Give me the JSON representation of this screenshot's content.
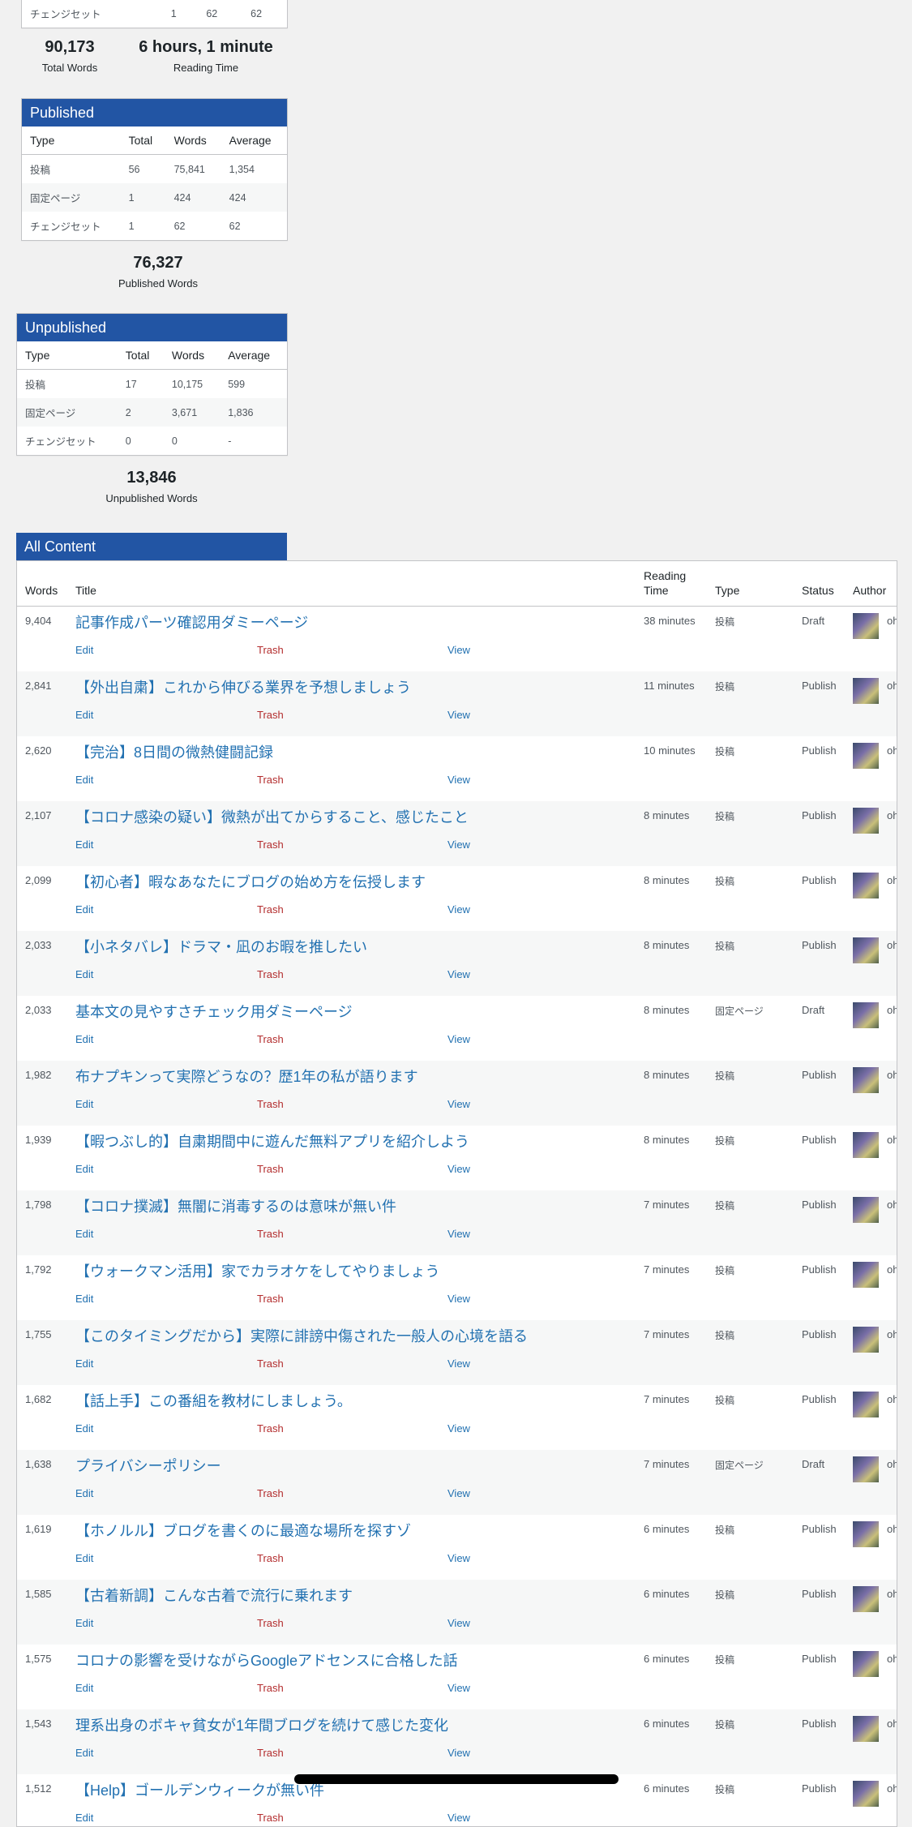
{
  "top_table": {
    "rows": [
      {
        "type": "チェンジセット",
        "total": "1",
        "words": "62",
        "average": "62"
      }
    ]
  },
  "total_words": {
    "value": "90,173",
    "label": "Total Words"
  },
  "reading_time": {
    "value": "6 hours, 1 minute",
    "label": "Reading Time"
  },
  "published": {
    "title": "Published",
    "headers": [
      "Type",
      "Total",
      "Words",
      "Average"
    ],
    "rows": [
      {
        "type": "投稿",
        "total": "56",
        "words": "75,841",
        "average": "1,354"
      },
      {
        "type": "固定ページ",
        "total": "1",
        "words": "424",
        "average": "424"
      },
      {
        "type": "チェンジセット",
        "total": "1",
        "words": "62",
        "average": "62"
      }
    ],
    "sum_value": "76,327",
    "sum_label": "Published Words"
  },
  "unpublished": {
    "title": "Unpublished",
    "headers": [
      "Type",
      "Total",
      "Words",
      "Average"
    ],
    "rows": [
      {
        "type": "投稿",
        "total": "17",
        "words": "10,175",
        "average": "599"
      },
      {
        "type": "固定ページ",
        "total": "2",
        "words": "3,671",
        "average": "1,836"
      },
      {
        "type": "チェンジセット",
        "total": "0",
        "words": "0",
        "average": "-"
      }
    ],
    "sum_value": "13,846",
    "sum_label": "Unpublished Words"
  },
  "all_content": {
    "title": "All Content",
    "headers": {
      "words": "Words",
      "title": "Title",
      "reading_time": "Reading\nTime",
      "type": "Type",
      "status": "Status",
      "author": "Author"
    },
    "action_edit": "Edit",
    "action_trash": "Trash",
    "action_view": "View",
    "rows": [
      {
        "words": "9,404",
        "title": "記事作成パーツ確認用ダミーページ",
        "reading_time": "38 minutes",
        "type": "投稿",
        "status": "Draft",
        "author": "ohno"
      },
      {
        "words": "2,841",
        "title": "【外出自粛】これから伸びる業界を予想しましょう",
        "reading_time": "11 minutes",
        "type": "投稿",
        "status": "Publish",
        "author": "ohno"
      },
      {
        "words": "2,620",
        "title": "【完治】8日間の微熱健闘記録",
        "reading_time": "10 minutes",
        "type": "投稿",
        "status": "Publish",
        "author": "ohno"
      },
      {
        "words": "2,107",
        "title": "【コロナ感染の疑い】微熱が出てからすること、感じたこと",
        "reading_time": "8 minutes",
        "type": "投稿",
        "status": "Publish",
        "author": "ohno"
      },
      {
        "words": "2,099",
        "title": "【初心者】暇なあなたにブログの始め方を伝授します",
        "reading_time": "8 minutes",
        "type": "投稿",
        "status": "Publish",
        "author": "ohno"
      },
      {
        "words": "2,033",
        "title": "【小ネタバレ】ドラマ・凪のお暇を推したい",
        "reading_time": "8 minutes",
        "type": "投稿",
        "status": "Publish",
        "author": "ohno"
      },
      {
        "words": "2,033",
        "title": "基本文の見やすさチェック用ダミーページ",
        "reading_time": "8 minutes",
        "type": "固定ページ",
        "status": "Draft",
        "author": "ohno"
      },
      {
        "words": "1,982",
        "title": "布ナプキンって実際どうなの？歴1年の私が語ります",
        "reading_time": "8 minutes",
        "type": "投稿",
        "status": "Publish",
        "author": "ohno"
      },
      {
        "words": "1,939",
        "title": "【暇つぶし的】自粛期間中に遊んだ無料アプリを紹介しよう",
        "reading_time": "8 minutes",
        "type": "投稿",
        "status": "Publish",
        "author": "ohno"
      },
      {
        "words": "1,798",
        "title": "【コロナ撲滅】無闇に消毒するのは意味が無い件",
        "reading_time": "7 minutes",
        "type": "投稿",
        "status": "Publish",
        "author": "ohno"
      },
      {
        "words": "1,792",
        "title": "【ウォークマン活用】家でカラオケをしてやりましょう",
        "reading_time": "7 minutes",
        "type": "投稿",
        "status": "Publish",
        "author": "ohno"
      },
      {
        "words": "1,755",
        "title": "【このタイミングだから】実際に誹謗中傷された一般人の心境を語る",
        "reading_time": "7 minutes",
        "type": "投稿",
        "status": "Publish",
        "author": "ohno"
      },
      {
        "words": "1,682",
        "title": "【話上手】この番組を教材にしましょう。",
        "reading_time": "7 minutes",
        "type": "投稿",
        "status": "Publish",
        "author": "ohno"
      },
      {
        "words": "1,638",
        "title": "プライバシーポリシー",
        "reading_time": "7 minutes",
        "type": "固定ページ",
        "status": "Draft",
        "author": "ohno"
      },
      {
        "words": "1,619",
        "title": "【ホノルル】ブログを書くのに最適な場所を探すゾ",
        "reading_time": "6 minutes",
        "type": "投稿",
        "status": "Publish",
        "author": "ohno"
      },
      {
        "words": "1,585",
        "title": "【古着新調】こんな古着で流行に乗れます",
        "reading_time": "6 minutes",
        "type": "投稿",
        "status": "Publish",
        "author": "ohno"
      },
      {
        "words": "1,575",
        "title": "コロナの影響を受けながらGoogleアドセンスに合格した話",
        "reading_time": "6 minutes",
        "type": "投稿",
        "status": "Publish",
        "author": "ohno"
      },
      {
        "words": "1,543",
        "title": "理系出身のボキャ貧女が1年間ブログを続けて感じた変化",
        "reading_time": "6 minutes",
        "type": "投稿",
        "status": "Publish",
        "author": "ohno"
      },
      {
        "words": "1,512",
        "title": "【Help】ゴールデンウィークが無い件",
        "reading_time": "6 minutes",
        "type": "投稿",
        "status": "Publish",
        "author": "ohno"
      }
    ]
  }
}
